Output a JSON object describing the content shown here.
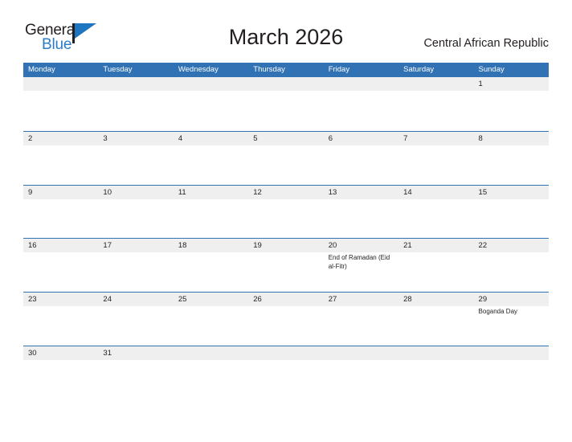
{
  "logo": {
    "word1": "General",
    "word2": "Blue",
    "flag_color": "#1f76c0"
  },
  "header": {
    "title": "March 2026",
    "country": "Central African Republic",
    "header_color": "#3072b4",
    "band_color": "#efefef"
  },
  "calendar": {
    "weekdays": [
      "Monday",
      "Tuesday",
      "Wednesday",
      "Thursday",
      "Friday",
      "Saturday",
      "Sunday"
    ],
    "weeks": [
      [
        {
          "day": ""
        },
        {
          "day": ""
        },
        {
          "day": ""
        },
        {
          "day": ""
        },
        {
          "day": ""
        },
        {
          "day": ""
        },
        {
          "day": "1"
        }
      ],
      [
        {
          "day": "2"
        },
        {
          "day": "3"
        },
        {
          "day": "4"
        },
        {
          "day": "5"
        },
        {
          "day": "6"
        },
        {
          "day": "7"
        },
        {
          "day": "8"
        }
      ],
      [
        {
          "day": "9"
        },
        {
          "day": "10"
        },
        {
          "day": "11"
        },
        {
          "day": "12"
        },
        {
          "day": "13"
        },
        {
          "day": "14"
        },
        {
          "day": "15"
        }
      ],
      [
        {
          "day": "16"
        },
        {
          "day": "17"
        },
        {
          "day": "18"
        },
        {
          "day": "19"
        },
        {
          "day": "20",
          "event": "End of Ramadan (Eid al-Fitr)"
        },
        {
          "day": "21"
        },
        {
          "day": "22"
        }
      ],
      [
        {
          "day": "23"
        },
        {
          "day": "24"
        },
        {
          "day": "25"
        },
        {
          "day": "26"
        },
        {
          "day": "27"
        },
        {
          "day": "28"
        },
        {
          "day": "29",
          "event": "Boganda Day"
        }
      ],
      [
        {
          "day": "30"
        },
        {
          "day": "31"
        },
        {
          "day": ""
        },
        {
          "day": ""
        },
        {
          "day": ""
        },
        {
          "day": ""
        },
        {
          "day": ""
        }
      ]
    ]
  }
}
